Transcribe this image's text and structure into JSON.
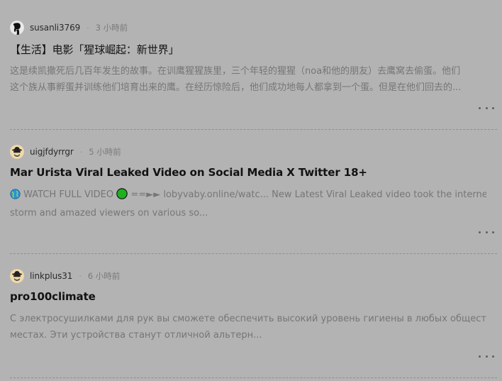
{
  "posts": [
    {
      "author": "susanli3769",
      "time": "3 小時前",
      "title": "【生活】电影「猩球崛起：新世界」",
      "excerpt_lines": [
        "这是续凯撒死后几百年发生的故事。在训鹰猩猩族里，三个年轻的猩猩（noa和他的朋友）去鹰窝去偷蛋。他们",
        "这个族从事孵蛋并训练他们培育出来的鹰。在经历惊险后，他们成功地每人都拿到一个蛋。但是在他们回去的..."
      ],
      "avatar_icon": "silhouette-avatar-icon"
    },
    {
      "author": "uigjfdyrrgr",
      "time": "5 小時前",
      "title": "Mar Urista Viral Leaked Video on Social Media X Twitter 18+",
      "excerpt_line1_prefix": "WATCH FULL VIDEO",
      "excerpt_line1_arrows": "==►►",
      "excerpt_line1_rest": "lobyvaby.online/watc... New Latest Viral Leaked video took the internet by",
      "excerpt_line2": "storm and amazed viewers on various so...",
      "avatar_icon": "spy-avatar-icon"
    },
    {
      "author": "linkplus31",
      "time": "6 小時前",
      "title": "pro100climate",
      "excerpt_lines": [
        "С электросушилками для рук вы сможете обеспечить высокий уровень гигиены в любых общественных",
        "местах. Эти устройства станут отличной альтерн..."
      ],
      "avatar_icon": "spy-avatar-icon"
    }
  ],
  "separator": "·",
  "colors": {
    "background": "#b3b3b3",
    "title": "#121212",
    "excerpt": "#767676",
    "green_circle": "#1fb01f"
  },
  "icons": {
    "globe": "globe-icon",
    "green_circle": "green-circle-icon",
    "more": "more-options-icon"
  }
}
